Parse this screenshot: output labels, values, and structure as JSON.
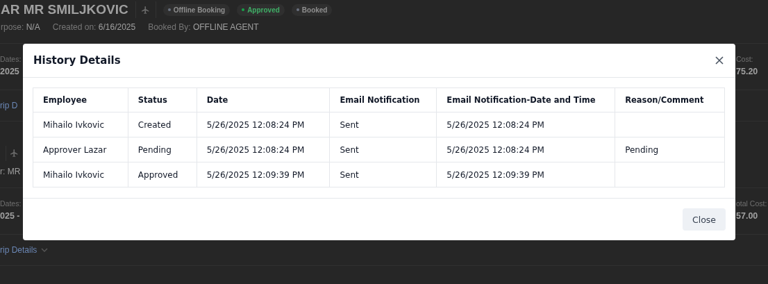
{
  "background": {
    "title": "AR MR SMILJKOVIC",
    "badges": [
      {
        "label": "Offline Booking",
        "color": "#6b7280"
      },
      {
        "label": "Approved",
        "color": "#16a34a"
      },
      {
        "label": "Booked",
        "color": "#6b7280"
      }
    ],
    "meta": [
      {
        "label": "rpose:",
        "value": "N/A"
      },
      {
        "label": "Created on:",
        "value": "6/16/2025"
      },
      {
        "label": "Booked By:",
        "value": "OFFLINE AGENT"
      }
    ],
    "cards": [
      {
        "dates_label": "Dates:",
        "dates": "2025",
        "cost_label": "Cost:",
        "cost": "75.20",
        "details": "rip D",
        "traveler_label": "r:",
        "traveler": "MR"
      },
      {
        "dates_label": "Dates:",
        "dates": "025 -",
        "cost_label": "otal Cost:",
        "cost": "57.00",
        "details": "rip Details"
      }
    ]
  },
  "dialog": {
    "title": "History Details",
    "columns": [
      "Employee",
      "Status",
      "Date",
      "Email Notification",
      "Email Notification-Date and Time",
      "Reason/Comment"
    ],
    "rows": [
      [
        "Mihailo Ivkovic",
        "Created",
        "5/26/2025 12:08:24 PM",
        "Sent",
        "5/26/2025 12:08:24 PM",
        ""
      ],
      [
        "Approver Lazar",
        "Pending",
        "5/26/2025 12:08:24 PM",
        "Sent",
        "5/26/2025 12:08:24 PM",
        "Pending"
      ],
      [
        "Mihailo Ivkovic",
        "Approved",
        "5/26/2025 12:09:39 PM",
        "Sent",
        "5/26/2025 12:09:39 PM",
        ""
      ]
    ],
    "close_button": "Close"
  }
}
